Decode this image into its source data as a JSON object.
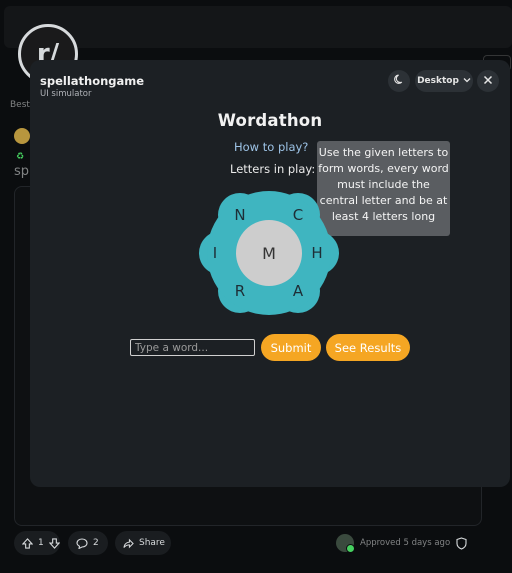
{
  "background": {
    "logo_text": "r/",
    "sort_label": "Best",
    "post_prefix": "sp",
    "actions": {
      "upvotes": "1",
      "comments": "2",
      "share_label": "Share",
      "approved_text": "Approved 5 days ago"
    }
  },
  "modal": {
    "app_name": "spellathongame",
    "app_subtitle": "UI simulator",
    "device_label": "Desktop",
    "icons": {
      "theme": "moon-icon",
      "device": "chevron-down-icon",
      "close": "close-icon"
    }
  },
  "game": {
    "title": "Wordathon",
    "how_to_play": "How to play?",
    "letters_label": "Letters in play:",
    "tooltip": "Use the given letters to form words, every word must include the central letter and be at least 4 letters long",
    "letters": {
      "center": "M",
      "outer": [
        "N",
        "C",
        "H",
        "A",
        "R",
        "I"
      ]
    },
    "input_placeholder": "Type a word...",
    "submit_label": "Submit",
    "results_label": "See Results",
    "colors": {
      "accent": "#f5a623",
      "flower": "#3fb5c0",
      "center": "#cdcdcd"
    }
  }
}
